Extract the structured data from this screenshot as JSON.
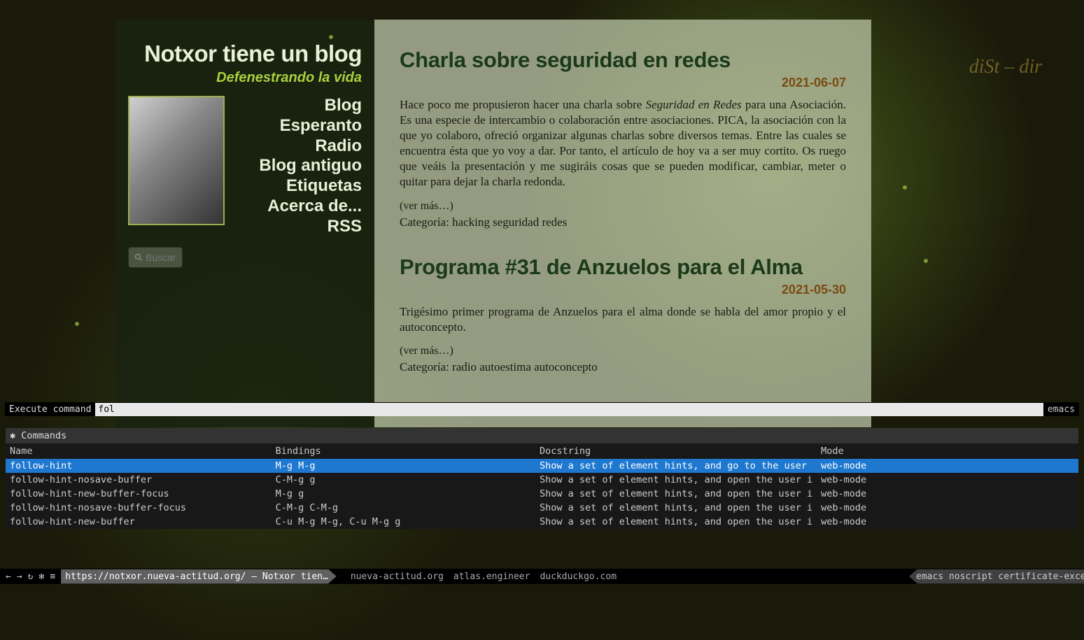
{
  "site": {
    "title": "Notxor tiene un blog",
    "subtitle": "Defenestrando la vida"
  },
  "nav": {
    "items": [
      "Blog",
      "Esperanto",
      "Radio",
      "Blog antiguo",
      "Etiquetas",
      "Acerca de...",
      "RSS"
    ]
  },
  "search": {
    "placeholder": "Buscar"
  },
  "posts": [
    {
      "title": "Charla sobre seguridad en redes",
      "date": "2021-06-07",
      "body_pre": "Hace poco me propusieron hacer una charla sobre ",
      "body_em": "Seguridad en Redes",
      "body_post": " para una Asociación. Es una especie de intercambio o colaboración entre asociaciones. PICA, la asociación con la que yo colaboro, ofreció organizar algunas charlas sobre diversos temas. Entre las cuales se encuentra ésta que yo voy a dar. Por tanto, el artículo de hoy va a ser muy cortito. Os ruego que veáis la presentación y me sugiráis cosas que se pueden modificar, cambiar, meter o quitar para dejar la charla redonda.",
      "more": "(ver más…)",
      "categoria_label": "Categoría: ",
      "categoria": "hacking seguridad redes"
    },
    {
      "title": "Programa #31 de Anzuelos para el Alma",
      "date": "2021-05-30",
      "body": "Trigésimo primer programa de Anzuelos para el alma donde se habla del amor propio y el autoconcepto.",
      "more": "(ver más…)",
      "categoria_label": "Categoría: ",
      "categoria": "radio autoestima autoconcepto"
    }
  ],
  "cmd": {
    "label": "Execute command",
    "value": "fol",
    "right": "emacs"
  },
  "commands_panel": {
    "heading": "✱ Commands",
    "columns": {
      "name": "Name",
      "bindings": "Bindings",
      "doc": "Docstring",
      "mode": "Mode"
    },
    "rows": [
      {
        "name": "follow-hint",
        "bind": "M-g M-g",
        "doc": "Show a set of element hints, and go to the user",
        "mode": "web-mode",
        "selected": true
      },
      {
        "name": "follow-hint-nosave-buffer",
        "bind": "C-M-g g",
        "doc": "Show a set of element hints, and open the user i",
        "mode": "web-mode"
      },
      {
        "name": "follow-hint-new-buffer-focus",
        "bind": "M-g g",
        "doc": "Show a set of element hints, and open the user i",
        "mode": "web-mode"
      },
      {
        "name": "follow-hint-nosave-buffer-focus",
        "bind": "C-M-g C-M-g",
        "doc": "Show a set of element hints, and open the user i",
        "mode": "web-mode"
      },
      {
        "name": "follow-hint-new-buffer",
        "bind": "C-u M-g M-g, C-u M-g g",
        "doc": "Show a set of element hints, and open the user i",
        "mode": "web-mode"
      }
    ]
  },
  "status": {
    "icons": {
      "back": "←",
      "forward": "→",
      "reload": "↻",
      "settings": "✻",
      "menu": "≡"
    },
    "tab_url": "https://notxor.nueva-actitud.org/",
    "tab_title_sep": " — ",
    "tab_title": "Notxor tien…",
    "hosts": [
      "nueva-actitud.org",
      "atlas.engineer",
      "duckduckgo.com"
    ],
    "modes": "emacs noscript certificate-excepti"
  }
}
